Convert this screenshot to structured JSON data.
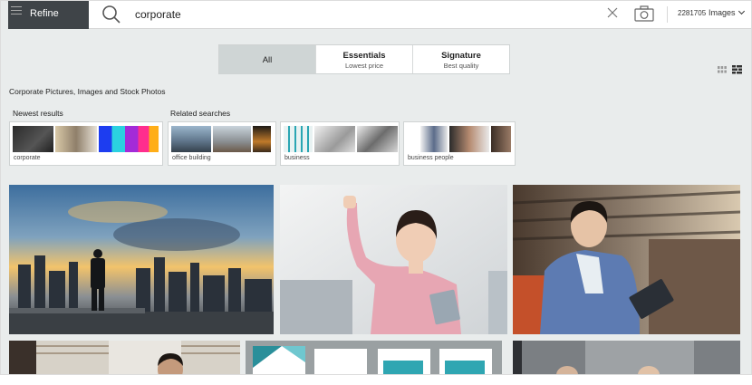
{
  "search": {
    "refine_label": "Refine",
    "query": "corporate",
    "result_count": "2281705",
    "media_type": "Images"
  },
  "tiers": [
    {
      "label": "All",
      "sub": ""
    },
    {
      "label": "Essentials",
      "sub": "Lowest price"
    },
    {
      "label": "Signature",
      "sub": "Best quality"
    }
  ],
  "page_title": "Corporate Pictures, Images and Stock Photos",
  "groups": {
    "newest_label": "Newest results",
    "related_label": "Related searches",
    "newest_caption": "corporate",
    "related": [
      "office building",
      "business",
      "business people"
    ]
  },
  "colors": {
    "refine_bg": "#3f4448",
    "page_bg": "#e9ecec",
    "active_tab": "#cfd5d5"
  }
}
